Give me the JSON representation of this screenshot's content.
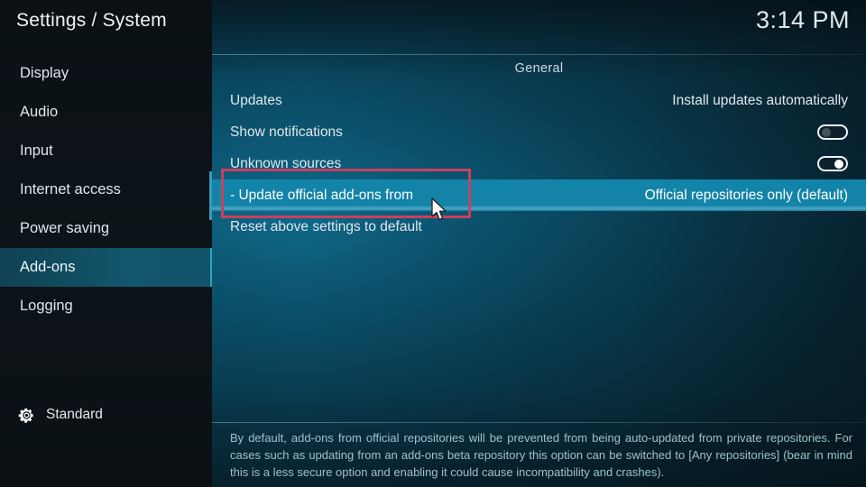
{
  "header": {
    "title": "Settings / System",
    "clock": "3:14 PM"
  },
  "sidebar": {
    "items": [
      {
        "label": "Display",
        "selected": false
      },
      {
        "label": "Audio",
        "selected": false
      },
      {
        "label": "Input",
        "selected": false
      },
      {
        "label": "Internet access",
        "selected": false
      },
      {
        "label": "Power saving",
        "selected": false
      },
      {
        "label": "Add-ons",
        "selected": true
      },
      {
        "label": "Logging",
        "selected": false
      }
    ],
    "footer": {
      "icon": "gear-icon",
      "label": "Standard"
    }
  },
  "main": {
    "group_title": "General",
    "rows": [
      {
        "label": "Updates",
        "value": "Install updates automatically",
        "control": "text",
        "selected": false
      },
      {
        "label": "Show notifications",
        "value": "off",
        "control": "toggle",
        "selected": false
      },
      {
        "label": "Unknown sources",
        "value": "on",
        "control": "toggle",
        "selected": false
      },
      {
        "label": "- Update official add-ons from",
        "value": "Official repositories only (default)",
        "control": "text",
        "selected": true
      },
      {
        "label": "Reset above settings to default",
        "value": "",
        "control": "none",
        "selected": false
      }
    ],
    "description": "By default, add-ons from official repositories will be prevented from being auto-updated from private repositories. For cases such as updating from an add-ons beta repository this option can be switched to [Any repositories] (bear in mind this is a less secure option and enabling it could cause incompatibility and crashes)."
  },
  "annotation": {
    "box_color": "#c9405e",
    "target_row": "- Update official add-ons from"
  },
  "colors": {
    "selected_row": "#1383a8",
    "sidebar_selected": "#114a5c",
    "panel_teal": "#0b5470",
    "description_text": "#9fc0cb",
    "annotation_red": "#c9405e"
  }
}
